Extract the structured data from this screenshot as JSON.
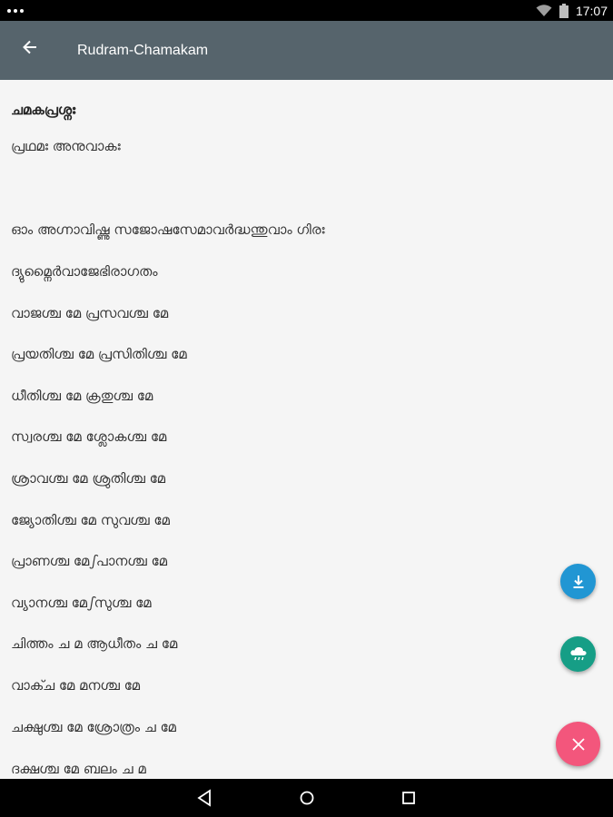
{
  "status_bar": {
    "time": "17:07",
    "icons": [
      "more-dots-icon",
      "wifi-icon",
      "battery-icon"
    ]
  },
  "app_bar": {
    "title": "Rudram-Chamakam",
    "back_icon": "arrow-back-icon",
    "color": "#56646c"
  },
  "content": {
    "heading": "ചമകപ്രശ്നഃ",
    "subheading": "പ്രഥമഃ അനുവാകഃ",
    "lines": [
      "ഓം അഗ്നാവിഷ്ണു സജോഷസേമാവർദ്ധന്തുവാം ഗിരഃ",
      "ദ്യുമ്നൈർവാജേഭിരാഗതം",
      "വാജശ്ച മേ പ്രസവശ്ച മേ",
      "പ്രയതിശ്ച മേ പ്രസിതിശ്ച മേ",
      "ധീതിശ്ച മേ ക്രതുശ്ച മേ",
      "സ്വരശ്ച മേ ശ്ലോകശ്ച മേ",
      "ശ്രാവശ്ച മേ ശ്രുതിശ്ച മേ",
      "ജ്യോതിശ്ച മേ സുവശ്ച മേ",
      "പ്രാണശ്ച മേഽപാനശ്ച മേ",
      "വ്യാനശ്ച മേഽസുശ്ച മേ",
      "ചിത്തം ച മ ആധീതം ച മേ",
      "വാക്ച മേ മനശ്ച മേ",
      "ചക്ഷുശ്ച മേ ശ്രോത്രം ച മേ",
      "ദക്ഷശ്ച മേ ബലം ച മ"
    ]
  },
  "fabs": {
    "download_icon": "download-icon",
    "download_color": "#2196d3",
    "cloud_icon": "cloud-rain-icon",
    "cloud_color": "#169e86",
    "close_icon": "close-icon",
    "close_color": "#f3567c"
  },
  "nav_bar": {
    "icons": [
      "back-triangle-icon",
      "home-circle-icon",
      "recents-square-icon"
    ]
  }
}
